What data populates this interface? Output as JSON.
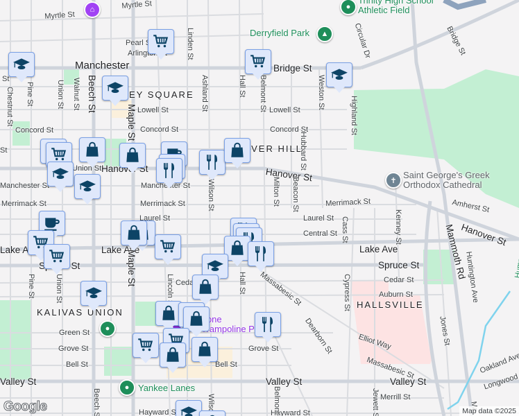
{
  "map": {
    "city_label": "Manchester",
    "neighborhoods": [
      "EY SQUARE",
      "OVER HILL",
      "HALLSVILLE",
      "KALIVAS UNION"
    ],
    "streets": {
      "myrtle1": "Myrtle St",
      "myrtle2": "Myrtle St",
      "pearl": "Pearl St",
      "arlington": "Arlington St",
      "linden": "Linden St",
      "bridge": "Bridge St",
      "bridge2": "Bridge St",
      "ashland": "Ashland St",
      "hall": "Hall St",
      "belmont": "Belmont St",
      "weston": "Weston St",
      "highland": "Highland St",
      "circular": "Circular Dr",
      "pine": "Pine St",
      "chestnut": "Chestnut St",
      "union": "Union St",
      "walnut": "Walnut St",
      "beech": "Beech St",
      "maple": "Maple St",
      "lowell": "Lowell St",
      "lowell2": "Lowell St",
      "concord": "Concord St",
      "concord2": "Concord St",
      "concord3": "Concord St",
      "hanover": "Hanover St",
      "hanover2": "Hanover St",
      "hanover3": "Hanover St",
      "manchester": "Manchester St",
      "manchester2": "Manchester St",
      "merrimack": "Merrimack St",
      "merrimack2": "Merrimack St",
      "merrimack3": "Merrimack St",
      "wilson": "Wilson St",
      "hubbard": "Hubbard St",
      "milton": "Milton St",
      "beacon": "Beacon St",
      "amherst": "Amherst St",
      "laurel": "Laurel St",
      "laurel2": "Laurel St",
      "central": "Central St",
      "cass": "Cass St",
      "kenney": "Kenney St",
      "lake": "Lake Ave",
      "lake2": "Lake Ave",
      "lake3": "Lake Ave",
      "spruce": "Spruce St",
      "spruce2": "Spruce St",
      "cedar": "Cedar St",
      "cedar2": "Cedar St",
      "auburn": "Auburn St",
      "mammoth": "Mammoth Rd",
      "huntington": "Huntington Ave",
      "massabesic": "Massabesic St",
      "massabesic2": "Massabesic St",
      "dearborn": "Dearborn St",
      "cypress": "Cypress St",
      "jones": "Jones St",
      "elliot": "Elliot Way",
      "oakland": "Oakland Ave",
      "longwood": "Longwood",
      "valley": "Valley St",
      "valley2": "Valley St",
      "valley3": "Valley St",
      "merrill": "Merrill St",
      "jewett": "Jewett St",
      "hayward": "Hayward St",
      "hayward2": "Hayward St",
      "green": "Green St",
      "grove": "Grove St",
      "grove2": "Grove St",
      "bell": "Bell St",
      "bell2": "Bell St",
      "lincoln": "Lincoln St",
      "hall2": "Hall St",
      "belmont2": "Belmont St",
      "union2": "Union St",
      "pine2": "Pine St",
      "beech2": "Beech St",
      "wilson2": "Wilson St",
      "maple2": "Maple St",
      "humphrey": "Hump",
      "ma": "Ma",
      "st_edge": "St",
      "st_edge2": "St"
    },
    "pois": {
      "trinity": "Trinity High School\nAthletic Field",
      "derryfield": "Derryfield Park",
      "saint_george": "Saint George's Greek\nOrthodox Cathedral",
      "trampoline": "Zone\nTrampoline Park",
      "yankee": "Yankee Lanes"
    },
    "attribution": "Map data ©2025",
    "logo": "Google",
    "colors": {
      "marker_bg": "#dfe8fb",
      "marker_icon": "#0d4466",
      "park": "#c3efd3",
      "hospital": "#fde3e3",
      "water": "#7fd3ed"
    }
  }
}
